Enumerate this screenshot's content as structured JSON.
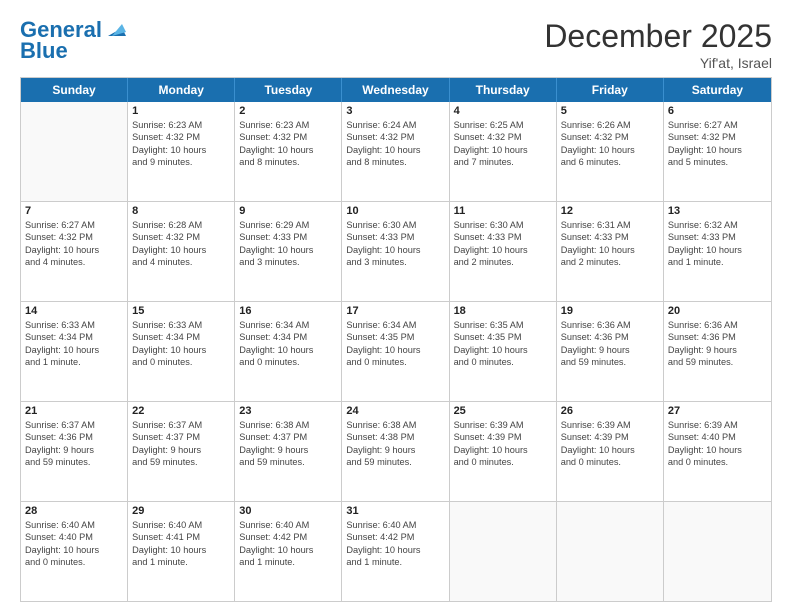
{
  "logo": {
    "part1": "General",
    "part2": "Blue"
  },
  "header": {
    "month": "December 2025",
    "location": "Yif'at, Israel"
  },
  "days": [
    "Sunday",
    "Monday",
    "Tuesday",
    "Wednesday",
    "Thursday",
    "Friday",
    "Saturday"
  ],
  "rows": [
    [
      {
        "day": "",
        "lines": []
      },
      {
        "day": "1",
        "lines": [
          "Sunrise: 6:23 AM",
          "Sunset: 4:32 PM",
          "Daylight: 10 hours",
          "and 9 minutes."
        ]
      },
      {
        "day": "2",
        "lines": [
          "Sunrise: 6:23 AM",
          "Sunset: 4:32 PM",
          "Daylight: 10 hours",
          "and 8 minutes."
        ]
      },
      {
        "day": "3",
        "lines": [
          "Sunrise: 6:24 AM",
          "Sunset: 4:32 PM",
          "Daylight: 10 hours",
          "and 8 minutes."
        ]
      },
      {
        "day": "4",
        "lines": [
          "Sunrise: 6:25 AM",
          "Sunset: 4:32 PM",
          "Daylight: 10 hours",
          "and 7 minutes."
        ]
      },
      {
        "day": "5",
        "lines": [
          "Sunrise: 6:26 AM",
          "Sunset: 4:32 PM",
          "Daylight: 10 hours",
          "and 6 minutes."
        ]
      },
      {
        "day": "6",
        "lines": [
          "Sunrise: 6:27 AM",
          "Sunset: 4:32 PM",
          "Daylight: 10 hours",
          "and 5 minutes."
        ]
      }
    ],
    [
      {
        "day": "7",
        "lines": [
          "Sunrise: 6:27 AM",
          "Sunset: 4:32 PM",
          "Daylight: 10 hours",
          "and 4 minutes."
        ]
      },
      {
        "day": "8",
        "lines": [
          "Sunrise: 6:28 AM",
          "Sunset: 4:32 PM",
          "Daylight: 10 hours",
          "and 4 minutes."
        ]
      },
      {
        "day": "9",
        "lines": [
          "Sunrise: 6:29 AM",
          "Sunset: 4:33 PM",
          "Daylight: 10 hours",
          "and 3 minutes."
        ]
      },
      {
        "day": "10",
        "lines": [
          "Sunrise: 6:30 AM",
          "Sunset: 4:33 PM",
          "Daylight: 10 hours",
          "and 3 minutes."
        ]
      },
      {
        "day": "11",
        "lines": [
          "Sunrise: 6:30 AM",
          "Sunset: 4:33 PM",
          "Daylight: 10 hours",
          "and 2 minutes."
        ]
      },
      {
        "day": "12",
        "lines": [
          "Sunrise: 6:31 AM",
          "Sunset: 4:33 PM",
          "Daylight: 10 hours",
          "and 2 minutes."
        ]
      },
      {
        "day": "13",
        "lines": [
          "Sunrise: 6:32 AM",
          "Sunset: 4:33 PM",
          "Daylight: 10 hours",
          "and 1 minute."
        ]
      }
    ],
    [
      {
        "day": "14",
        "lines": [
          "Sunrise: 6:33 AM",
          "Sunset: 4:34 PM",
          "Daylight: 10 hours",
          "and 1 minute."
        ]
      },
      {
        "day": "15",
        "lines": [
          "Sunrise: 6:33 AM",
          "Sunset: 4:34 PM",
          "Daylight: 10 hours",
          "and 0 minutes."
        ]
      },
      {
        "day": "16",
        "lines": [
          "Sunrise: 6:34 AM",
          "Sunset: 4:34 PM",
          "Daylight: 10 hours",
          "and 0 minutes."
        ]
      },
      {
        "day": "17",
        "lines": [
          "Sunrise: 6:34 AM",
          "Sunset: 4:35 PM",
          "Daylight: 10 hours",
          "and 0 minutes."
        ]
      },
      {
        "day": "18",
        "lines": [
          "Sunrise: 6:35 AM",
          "Sunset: 4:35 PM",
          "Daylight: 10 hours",
          "and 0 minutes."
        ]
      },
      {
        "day": "19",
        "lines": [
          "Sunrise: 6:36 AM",
          "Sunset: 4:36 PM",
          "Daylight: 9 hours",
          "and 59 minutes."
        ]
      },
      {
        "day": "20",
        "lines": [
          "Sunrise: 6:36 AM",
          "Sunset: 4:36 PM",
          "Daylight: 9 hours",
          "and 59 minutes."
        ]
      }
    ],
    [
      {
        "day": "21",
        "lines": [
          "Sunrise: 6:37 AM",
          "Sunset: 4:36 PM",
          "Daylight: 9 hours",
          "and 59 minutes."
        ]
      },
      {
        "day": "22",
        "lines": [
          "Sunrise: 6:37 AM",
          "Sunset: 4:37 PM",
          "Daylight: 9 hours",
          "and 59 minutes."
        ]
      },
      {
        "day": "23",
        "lines": [
          "Sunrise: 6:38 AM",
          "Sunset: 4:37 PM",
          "Daylight: 9 hours",
          "and 59 minutes."
        ]
      },
      {
        "day": "24",
        "lines": [
          "Sunrise: 6:38 AM",
          "Sunset: 4:38 PM",
          "Daylight: 9 hours",
          "and 59 minutes."
        ]
      },
      {
        "day": "25",
        "lines": [
          "Sunrise: 6:39 AM",
          "Sunset: 4:39 PM",
          "Daylight: 10 hours",
          "and 0 minutes."
        ]
      },
      {
        "day": "26",
        "lines": [
          "Sunrise: 6:39 AM",
          "Sunset: 4:39 PM",
          "Daylight: 10 hours",
          "and 0 minutes."
        ]
      },
      {
        "day": "27",
        "lines": [
          "Sunrise: 6:39 AM",
          "Sunset: 4:40 PM",
          "Daylight: 10 hours",
          "and 0 minutes."
        ]
      }
    ],
    [
      {
        "day": "28",
        "lines": [
          "Sunrise: 6:40 AM",
          "Sunset: 4:40 PM",
          "Daylight: 10 hours",
          "and 0 minutes."
        ]
      },
      {
        "day": "29",
        "lines": [
          "Sunrise: 6:40 AM",
          "Sunset: 4:41 PM",
          "Daylight: 10 hours",
          "and 1 minute."
        ]
      },
      {
        "day": "30",
        "lines": [
          "Sunrise: 6:40 AM",
          "Sunset: 4:42 PM",
          "Daylight: 10 hours",
          "and 1 minute."
        ]
      },
      {
        "day": "31",
        "lines": [
          "Sunrise: 6:40 AM",
          "Sunset: 4:42 PM",
          "Daylight: 10 hours",
          "and 1 minute."
        ]
      },
      {
        "day": "",
        "lines": []
      },
      {
        "day": "",
        "lines": []
      },
      {
        "day": "",
        "lines": []
      }
    ]
  ]
}
